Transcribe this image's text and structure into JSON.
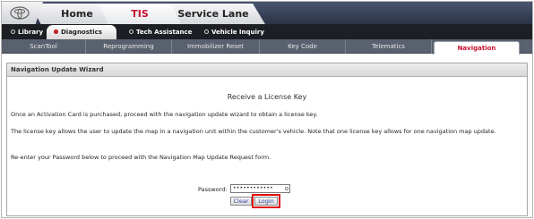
{
  "header": {
    "tabs": [
      {
        "label": "Home"
      },
      {
        "label": "TIS",
        "active": true
      },
      {
        "label": "Service Lane"
      }
    ]
  },
  "subnav": {
    "tabs": [
      {
        "label": "Library"
      },
      {
        "label": "Diagnostics",
        "active": true
      },
      {
        "label": "Tech Assistance"
      },
      {
        "label": "Vehicle Inquiry"
      }
    ]
  },
  "menu": {
    "items": [
      {
        "label": "ScanTool"
      },
      {
        "label": "Reprogramming"
      },
      {
        "label": "Immobilizer Reset"
      },
      {
        "label": "Key Code"
      },
      {
        "label": "Telematics"
      },
      {
        "label": "Navigation",
        "active": true
      }
    ]
  },
  "panel": {
    "header": "Navigation Update Wizard",
    "title": "Receive a License Key",
    "para1": "Once an Activation Card is purchased, proceed with the navigation update wizard to obtain a license key.",
    "para2": "The license key allows the user to update the map in a navigation unit within the customer's vehicle. Note that one license key allows for one navigation map update.",
    "para3": "Re-enter your Password below to proceed with the Navigation Map Update Request form.",
    "password_label": "Password:",
    "password_value": "••••••••••••",
    "clear_label": "Clear",
    "login_label": "Login"
  },
  "colors": {
    "accent_red": "#c8102e",
    "menu_bg": "#59606e",
    "highlight_outline": "#e01010"
  }
}
